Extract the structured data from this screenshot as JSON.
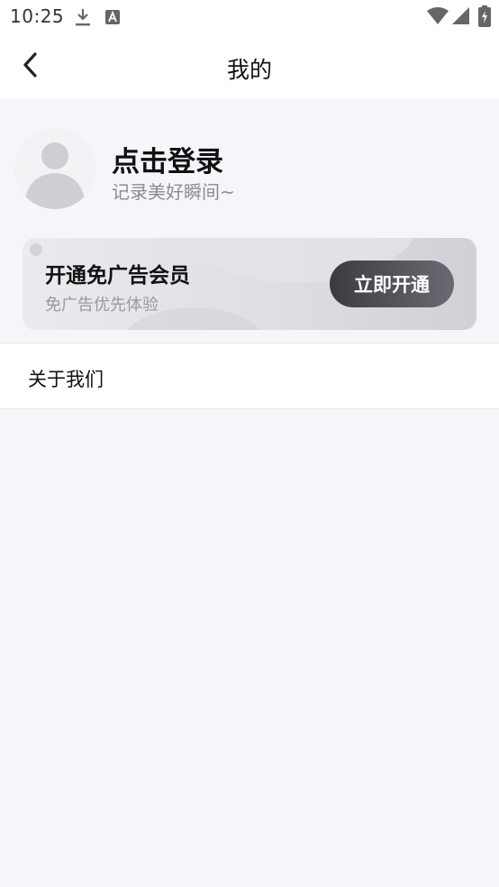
{
  "status_bar": {
    "time": "10:25",
    "icons": [
      "download-icon",
      "font-icon",
      "wifi-icon",
      "signal-icon",
      "battery-icon"
    ]
  },
  "nav": {
    "title": "我的",
    "back_icon": "chevron-left-icon"
  },
  "profile": {
    "login_text": "点击登录",
    "subtitle": "记录美好瞬间~",
    "avatar_icon": "avatar-placeholder-icon"
  },
  "vip": {
    "title": "开通免广告会员",
    "subtitle": "免广告优先体验",
    "button_label": "立即开通"
  },
  "menu": {
    "items": [
      {
        "label": "关于我们"
      }
    ]
  },
  "colors": {
    "page_bg": "#f5f6fa",
    "card_bg": "#ffffff",
    "vip_button": "#3b3b3f"
  }
}
